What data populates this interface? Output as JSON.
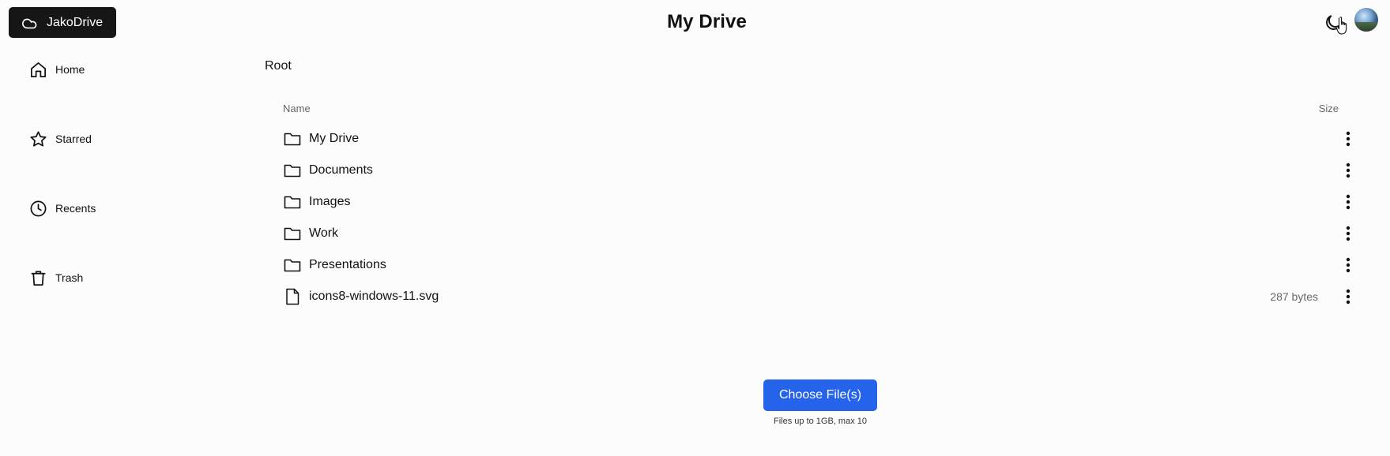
{
  "brand": {
    "name": "JakoDrive",
    "icon": "cloud-icon"
  },
  "header": {
    "title": "My Drive",
    "theme_icon": "moon-icon",
    "avatar": "user-avatar"
  },
  "sidebar": {
    "items": [
      {
        "label": "Home",
        "icon": "home-icon"
      },
      {
        "label": "Starred",
        "icon": "star-icon"
      },
      {
        "label": "Recents",
        "icon": "clock-icon"
      },
      {
        "label": "Trash",
        "icon": "trash-icon"
      }
    ]
  },
  "breadcrumb": {
    "current": "Root"
  },
  "table": {
    "columns": {
      "name": "Name",
      "size": "Size"
    },
    "rows": [
      {
        "name": "My Drive",
        "type": "folder",
        "size": ""
      },
      {
        "name": "Documents",
        "type": "folder",
        "size": ""
      },
      {
        "name": "Images",
        "type": "folder",
        "size": ""
      },
      {
        "name": "Work",
        "type": "folder",
        "size": ""
      },
      {
        "name": "Presentations",
        "type": "folder",
        "size": ""
      },
      {
        "name": "icons8-windows-11.svg",
        "type": "file",
        "size": "287 bytes"
      }
    ]
  },
  "upload": {
    "button_label": "Choose File(s)",
    "hint": "Files up to 1GB, max 10"
  }
}
